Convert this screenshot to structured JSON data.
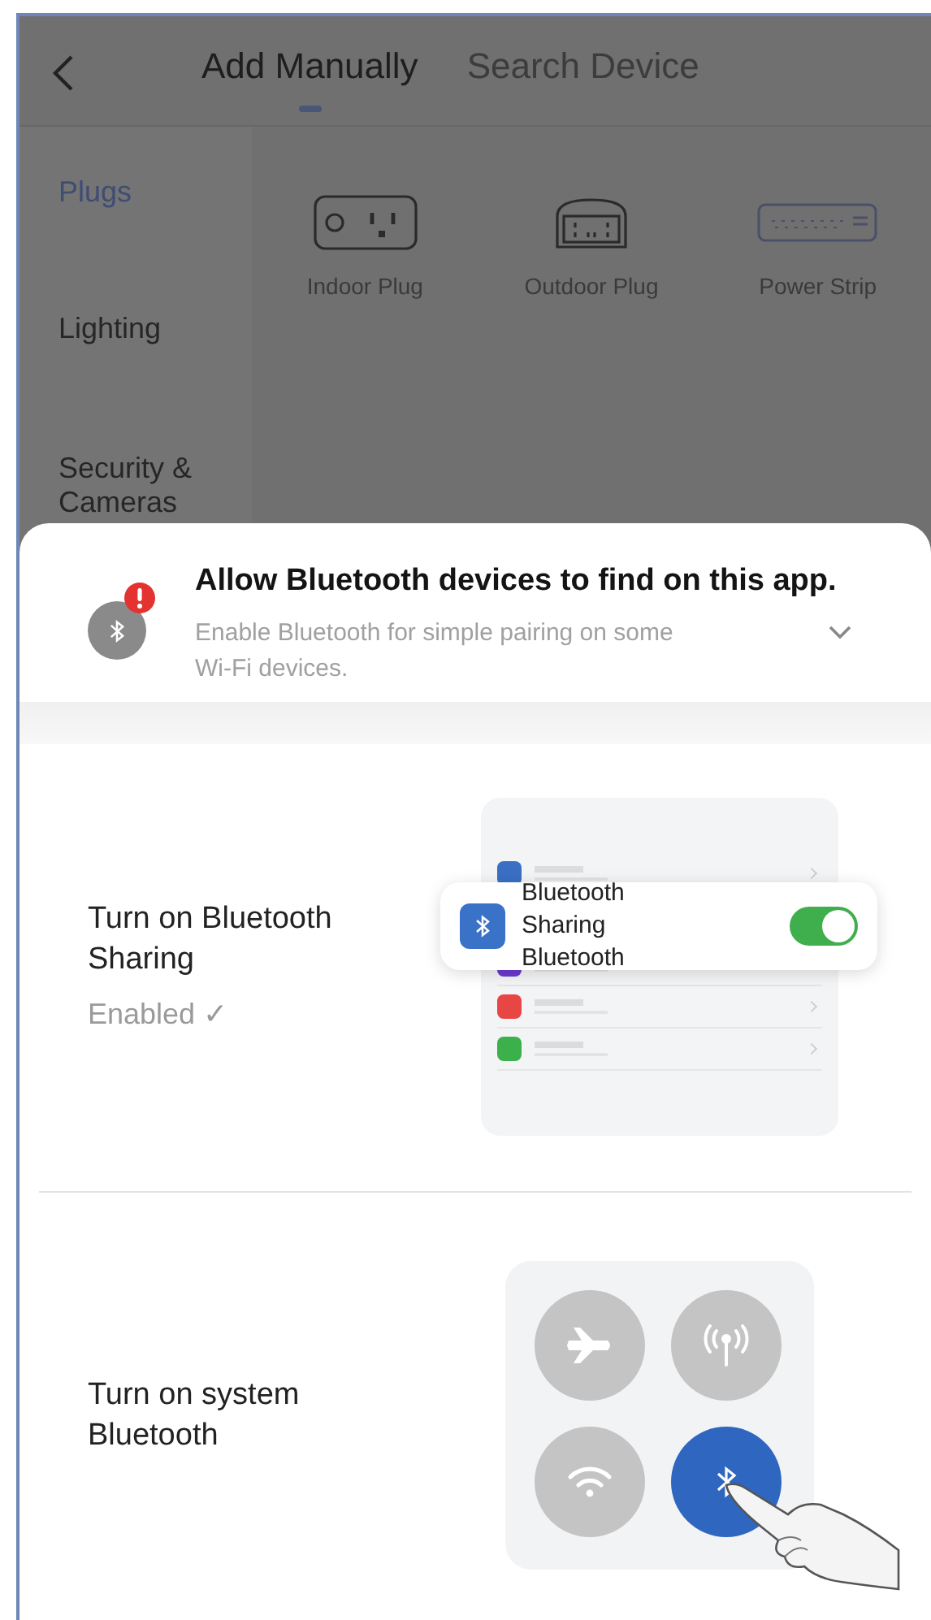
{
  "tabs": [
    {
      "label": "Add Manually",
      "selected": true
    },
    {
      "label": "Search Device",
      "selected": false
    }
  ],
  "categories": [
    {
      "label": "Plugs",
      "selected": true
    },
    {
      "label": "Lighting",
      "selected": false
    },
    {
      "label": "Security & Cameras",
      "selected": false
    }
  ],
  "devices": [
    {
      "kind": "indoor",
      "label": "Indoor Plug"
    },
    {
      "kind": "outdoor",
      "label": "Outdoor Plug"
    },
    {
      "kind": "strip",
      "label": "Power Strip"
    }
  ],
  "prompt": {
    "title": "Allow Bluetooth devices to find on this app.",
    "subtitle": "Enable Bluetooth for simple pairing on some Wi-Fi devices.",
    "expanded": false
  },
  "steps": [
    {
      "kind": "sharing",
      "title": "Turn on Bluetooth Sharing",
      "status": "Enabled ✓",
      "card_label": "Bluetooth Sharing Bluetooth",
      "on": true
    },
    {
      "kind": "system",
      "title": "Turn on system Bluetooth",
      "on": true
    }
  ]
}
